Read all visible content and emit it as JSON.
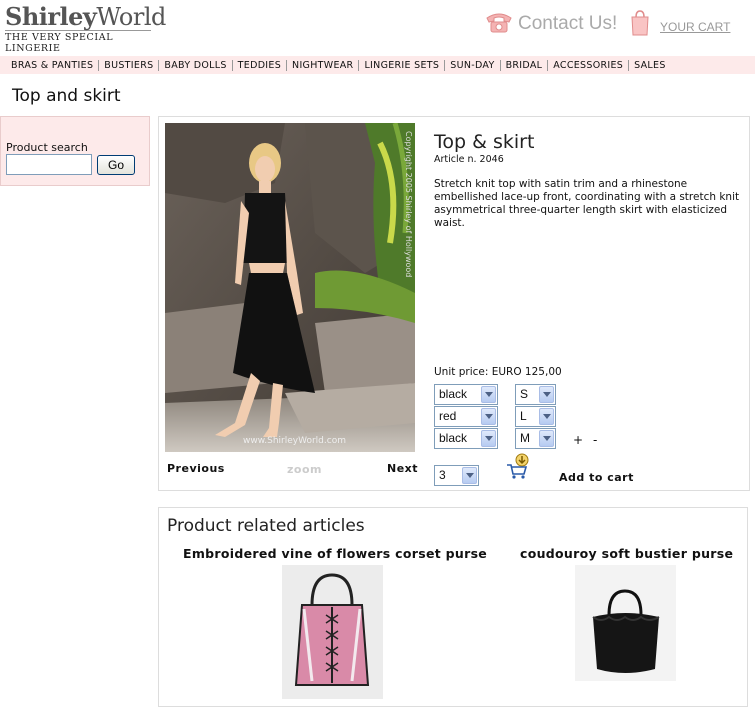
{
  "header": {
    "logo_part1": "Shirley",
    "logo_part2": "World",
    "logo_tagline": "THE VERY SPECIAL LINGERIE",
    "contact_label": "Contact Us!",
    "cart_label": "YOUR CART"
  },
  "nav": {
    "items": [
      "BRAS & PANTIES",
      "BUSTIERS",
      "BABY DOLLS",
      "TEDDIES",
      "NIGHTWEAR",
      "LINGERIE SETS",
      "SUN-DAY",
      "BRIDAL",
      "ACCESSORIES",
      "SALES"
    ]
  },
  "page_title": "Top and skirt",
  "search": {
    "label": "Product search",
    "value": "",
    "button": "Go"
  },
  "product": {
    "title": "Top & skirt",
    "article": "Article n. 2046",
    "description": "Stretch knit top with satin trim and a rhinestone embellished lace-up front, coordinating with a stretch knit asymmetrical three-quarter length skirt with elasticized waist.",
    "unit_price": "Unit price: EURO 125,00",
    "photo_watermark": "www.ShirleyWorld.com",
    "photo_copyright": "Copyright 2005 Shirley of Hollywood",
    "color_selects": [
      "black",
      "red",
      "black"
    ],
    "size_selects": [
      "S",
      "L",
      "M"
    ],
    "plus": "+",
    "minus": "-",
    "quantity": "3",
    "previous": "Previous",
    "zoom": "zoom",
    "next": "Next",
    "add_to_cart": "Add to cart"
  },
  "related": {
    "heading": "Product related articles",
    "items": [
      {
        "title": "Embroidered vine of flowers corset purse"
      },
      {
        "title": "coudouroy soft bustier purse"
      }
    ]
  },
  "colors": {
    "nav_bg": "#fdeaea",
    "search_bg": "#fdeaea",
    "border": "#dddddd",
    "link_muted": "#999999"
  }
}
